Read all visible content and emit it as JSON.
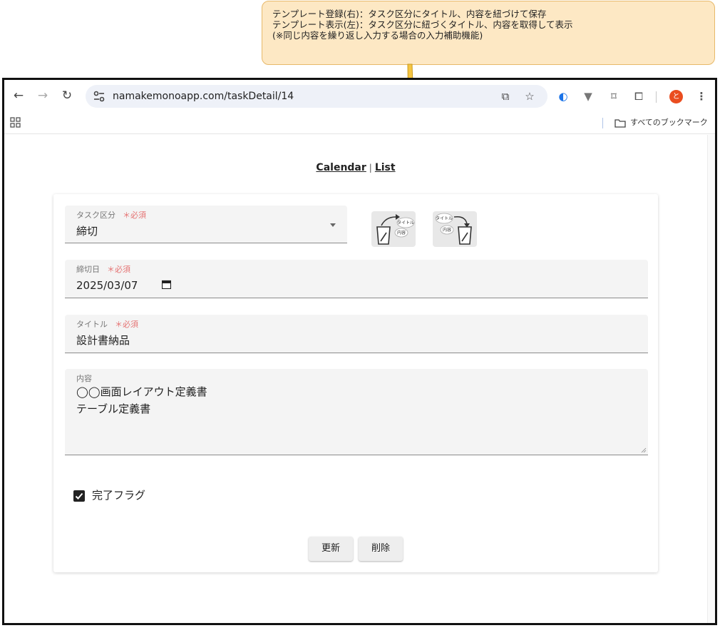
{
  "annotation": {
    "lines": [
      "テンプレート登録(右)：タスク区分にタイトル、内容を紐づけて保存",
      "テンプレート表示(左)：タスク区分に紐づくタイトル、内容を取得して表示",
      "(※同じ内容を繰り返し入力する場合の入力補助機能)"
    ]
  },
  "browser": {
    "url": "namakemonoapp.com/taskDetail/14",
    "profile_initial": "と",
    "bookmarks_label": "すべてのブックマーク"
  },
  "nav": {
    "calendar": "Calendar",
    "separator": "|",
    "list": "List"
  },
  "form": {
    "required_mark": "＊必須",
    "task_type": {
      "label": "タスク区分",
      "value": "締切"
    },
    "deadline": {
      "label": "締切日",
      "value": "2025/03/07"
    },
    "title": {
      "label": "タイトル",
      "value": "設計書納品"
    },
    "content": {
      "label": "内容",
      "lines": [
        "◯◯画面レイアウト定義書",
        "テーブル定義書"
      ]
    },
    "done_flag": {
      "label": "完了フラグ",
      "checked": true
    },
    "template_register": {
      "tag_title": "タイトル",
      "tag_content": "内容"
    },
    "template_show": {
      "tag_title": "タイトル",
      "tag_content": "内容"
    },
    "update_label": "更新",
    "delete_label": "削除"
  },
  "colors": {
    "required": "#e57373",
    "profile": "#ea4d1f",
    "callout_bg": "#fde8c4",
    "arrow": "#f5c542"
  }
}
